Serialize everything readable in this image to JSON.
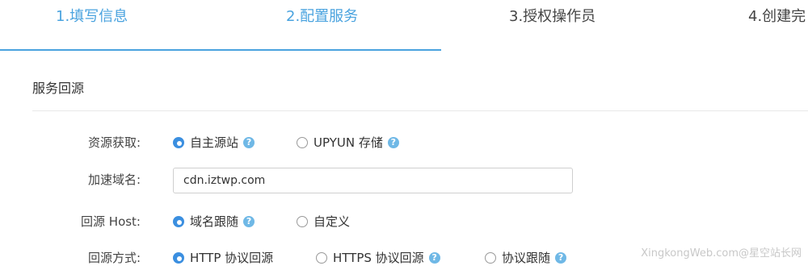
{
  "steps": [
    {
      "label": "1.填写信息",
      "status": "done"
    },
    {
      "label": "2.配置服务",
      "status": "active"
    },
    {
      "label": "3.授权操作员",
      "status": "pending"
    },
    {
      "label": "4.创建完",
      "status": "pending"
    }
  ],
  "section": {
    "title": "服务回源"
  },
  "form": {
    "resource": {
      "label": "资源获取:",
      "options": [
        {
          "label": "自主源站",
          "checked": true,
          "help": true
        },
        {
          "label": "UPYUN 存储",
          "checked": false,
          "help": true
        }
      ]
    },
    "domain": {
      "label": "加速域名:",
      "value": "cdn.iztwp.com"
    },
    "origin_host": {
      "label": "回源 Host:",
      "options": [
        {
          "label": "域名跟随",
          "checked": true,
          "help": true
        },
        {
          "label": "自定义",
          "checked": false,
          "help": false
        }
      ]
    },
    "origin_method": {
      "label": "回源方式:",
      "options": [
        {
          "label": "HTTP 协议回源",
          "checked": true,
          "help": false
        },
        {
          "label": "HTTPS 协议回源",
          "checked": false,
          "help": true
        },
        {
          "label": "协议跟随",
          "checked": false,
          "help": true
        }
      ]
    }
  },
  "help_glyph": "?",
  "watermark": "XingkongWeb.com@星空站长网",
  "colors": {
    "accent": "#4aa3df",
    "radio_checked": "#3b8fe0",
    "help_icon": "#6fb8e6"
  }
}
